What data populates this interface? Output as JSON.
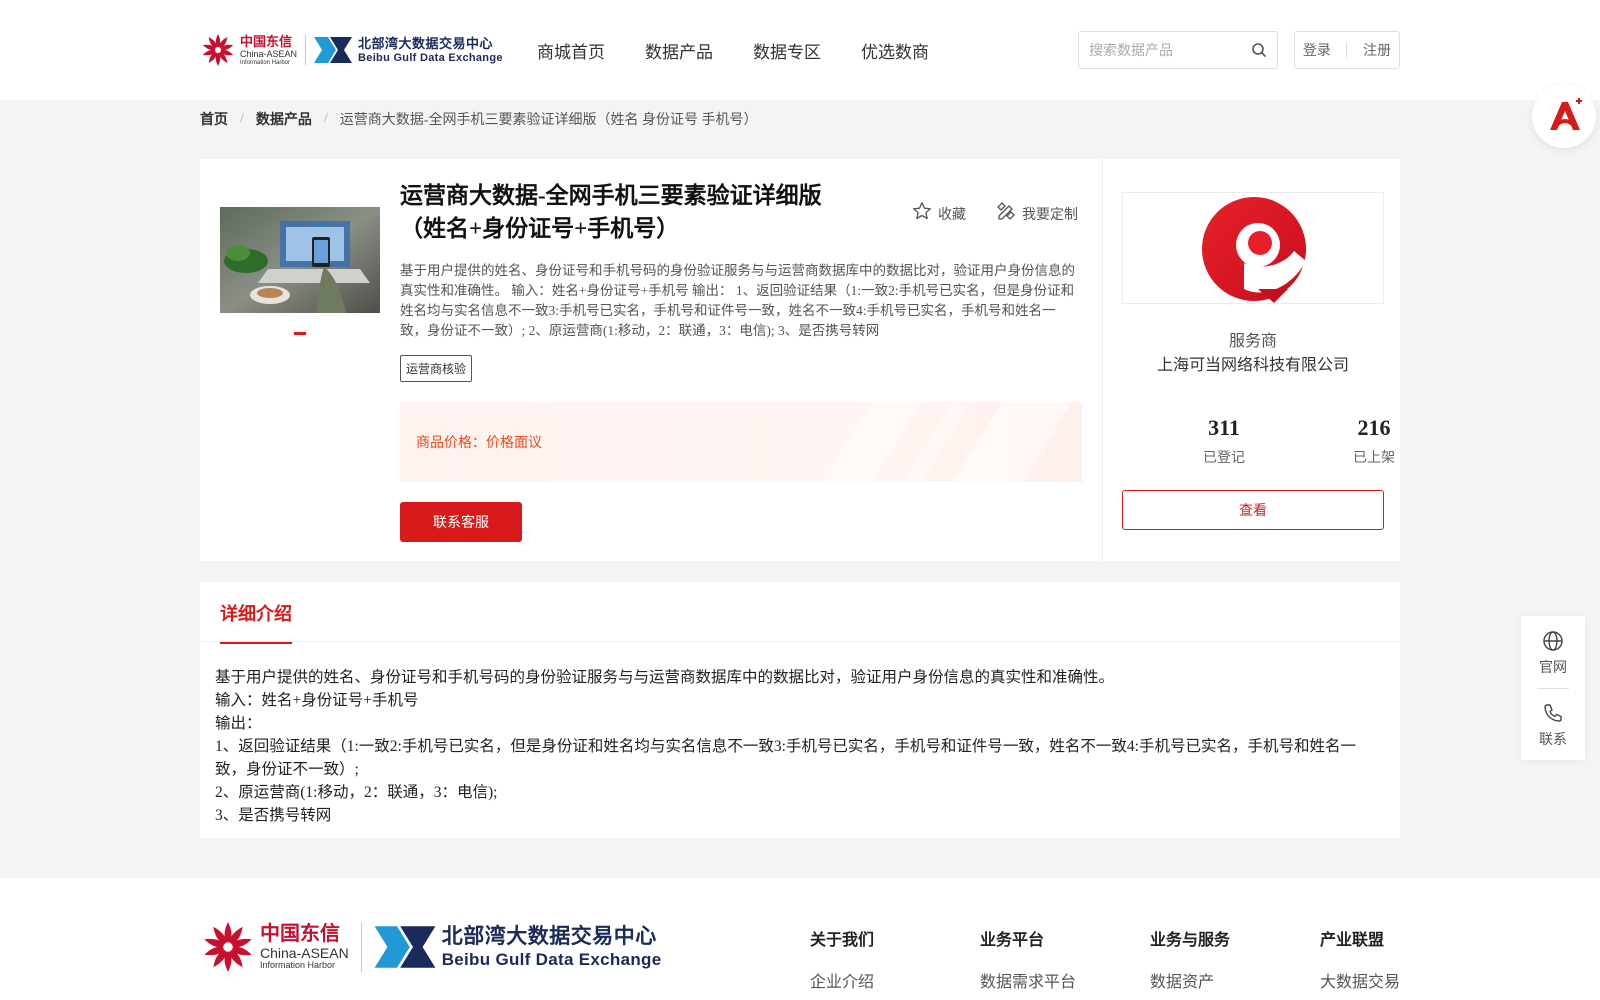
{
  "brand": {
    "logo_cn": "中国东信",
    "logo_en1": "China-ASEAN",
    "logo_en2": "Information Harbor",
    "bbg_cn": "北部湾大数据交易中心",
    "bbg_en": "Beibu Gulf Data Exchange"
  },
  "nav": {
    "items": [
      "商城首页",
      "数据产品",
      "数据专区",
      "优选数商"
    ]
  },
  "search": {
    "placeholder": "搜索数据产品",
    "value": ""
  },
  "auth": {
    "login": "登录",
    "register": "注册"
  },
  "breadcrumb": {
    "home": "首页",
    "category": "数据产品",
    "current": "运营商大数据-全网手机三要素验证详细版（姓名 身份证号 手机号）"
  },
  "product": {
    "title": "运营商大数据-全网手机三要素验证详细版（姓名+身份证号+手机号）",
    "favorite_label": "收藏",
    "customize_label": "我要定制",
    "description": "基于用户提供的姓名、身份证号和手机号码的身份验证服务与与运营商数据库中的数据比对，验证用户身份信息的真实性和准确性。 输入：姓名+身份证号+手机号 输出： 1、返回验证结果（1:一致2:手机号已实名，但是身份证和姓名均与实名信息不一致3:手机号已实名，手机号和证件号一致，姓名不一致4:手机号已实名，手机号和姓名一致，身份证不一致）; 2、原运营商(1:移动，2：联通，3：电信); 3、是否携号转网",
    "tag": "运营商核验",
    "price_label": "商品价格：",
    "price_value": "价格面议",
    "contact_button": "联系客服"
  },
  "provider": {
    "role": "服务商",
    "name": "上海可当网络科技有限公司",
    "registered_count": "311",
    "registered_label": "已登记",
    "listed_count": "216",
    "listed_label": "已上架",
    "view_button": "查看"
  },
  "detail": {
    "tab_label": "详细介绍",
    "lines": [
      "基于用户提供的姓名、身份证号和手机号码的身份验证服务与与运营商数据库中的数据比对，验证用户身份信息的真实性和准确性。",
      "输入：姓名+身份证号+手机号",
      "输出：",
      "1、返回验证结果（1:一致2:手机号已实名，但是身份证和姓名均与实名信息不一致3:手机号已实名，手机号和证件号一致，姓名不一致4:手机号已实名，手机号和姓名一致，身份证不一致）;",
      "2、原运营商(1:移动，2：联通，3：电信);",
      "3、是否携号转网"
    ]
  },
  "side_tools": {
    "website_label": "官网",
    "contact_label": "联系"
  },
  "footer": {
    "columns": [
      {
        "head": "关于我们",
        "link": "企业介绍"
      },
      {
        "head": "业务平台",
        "link": "数据需求平台"
      },
      {
        "head": "业务与服务",
        "link": "数据资产"
      },
      {
        "head": "产业联盟",
        "link": "大数据交易"
      }
    ]
  },
  "colors": {
    "accent": "#d71a1a",
    "price": "#e8491d",
    "brand_navy": "#1a2a5a",
    "brand_blue": "#1f9ad6"
  },
  "icons": [
    "search-icon",
    "star-icon",
    "customize-icon",
    "globe-icon",
    "phone-icon",
    "ai-assistant-icon"
  ]
}
